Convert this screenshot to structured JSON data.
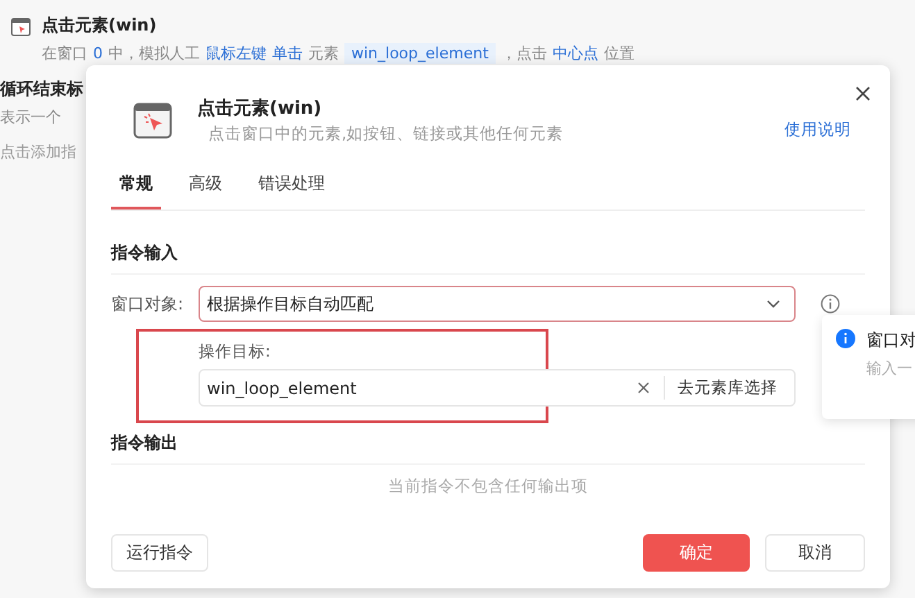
{
  "background_list": {
    "items": [
      {
        "title": "点击元素(win)",
        "description": [
          {
            "text": "在窗口",
            "kind": "plain"
          },
          {
            "text": "0",
            "kind": "value"
          },
          {
            "text": "中，模拟人工",
            "kind": "plain"
          },
          {
            "text": "鼠标左键",
            "kind": "value"
          },
          {
            "text": "单击",
            "kind": "value"
          },
          {
            "text": "元素",
            "kind": "plain"
          },
          {
            "text": "win_loop_element",
            "kind": "tag"
          },
          {
            "text": "，点击",
            "kind": "plain"
          },
          {
            "text": "中心点",
            "kind": "value"
          },
          {
            "text": "位置",
            "kind": "plain"
          }
        ]
      },
      {
        "title": "循环结束标",
        "description": [
          {
            "text": "表示一个",
            "kind": "plain"
          }
        ]
      }
    ],
    "add_hint": "点击添加指"
  },
  "dialog": {
    "title": "点击元素(win)",
    "subtitle": "点击窗口中的元素,如按钮、链接或其他任何元素",
    "help_link": "使用说明",
    "tabs": [
      {
        "label": "常规",
        "selected": true
      },
      {
        "label": "高级",
        "selected": false
      },
      {
        "label": "错误处理",
        "selected": false
      }
    ],
    "input_section": {
      "heading": "指令输入",
      "window_label": "窗口对象:",
      "window_value": "根据操作目标自动匹配",
      "target_label": "操作目标:",
      "target_value": "win_loop_element",
      "library_button": "去元素库选择"
    },
    "output_section": {
      "heading": "指令输出",
      "empty_text": "当前指令不包含任何输出项"
    },
    "buttons": {
      "run": "运行指令",
      "ok": "确定",
      "cancel": "取消"
    }
  },
  "popover": {
    "title": "窗口对",
    "text": "输入一"
  }
}
